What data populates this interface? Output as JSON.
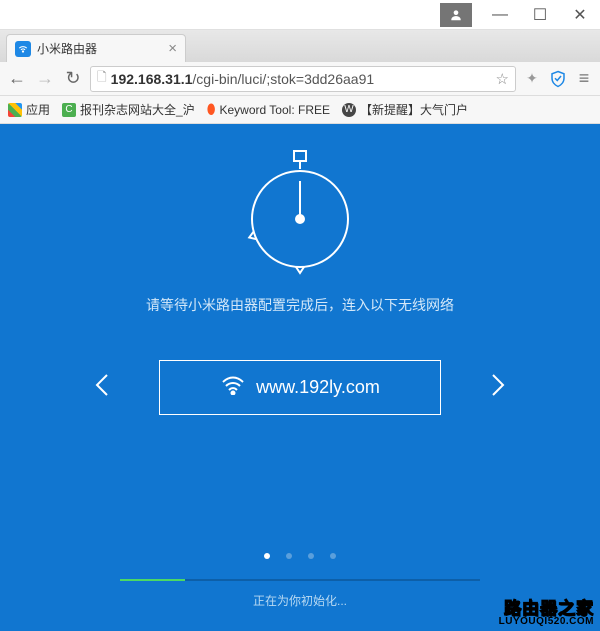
{
  "window": {
    "minimize": "—",
    "maximize": "☐",
    "close": "✕"
  },
  "tab": {
    "title": "小米路由器",
    "close": "×"
  },
  "toolbar": {
    "back": "←",
    "forward": "→",
    "reload": "↻",
    "url_host": "192.168.31.1",
    "url_path": "/cgi-bin/luci/;stok=3dd26aa91",
    "star": "☆",
    "wand": "✦",
    "menu": "≡"
  },
  "bookmarks": {
    "apps": "应用",
    "items": [
      "报刊杂志网站大全_沪",
      "Keyword Tool: FREE",
      "【新提醒】大气门户"
    ]
  },
  "page": {
    "instruction": "请等待小米路由器配置完成后，连入以下无线网络",
    "wifi_ssid": "www.192ly.com",
    "progress_text": "正在为你初始化...",
    "progress_percent": 18,
    "dots_active_index": 0,
    "dots_count": 4
  },
  "watermark": {
    "cn": "路由器之家",
    "en": "LUYOUQI520.COM"
  }
}
